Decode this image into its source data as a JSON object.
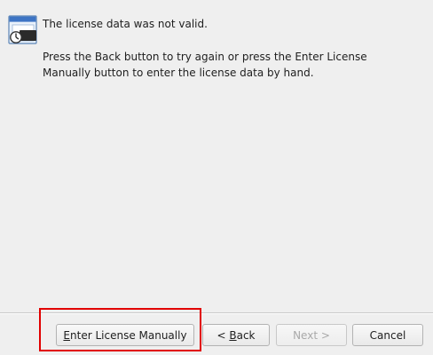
{
  "icon": {
    "name": "wizard-window-icon"
  },
  "message": {
    "title": "The license data was not valid.",
    "body": "Press the Back button to try again or press the Enter License Manually button to enter the license data by hand."
  },
  "buttons": {
    "enter_manual": {
      "mnemonic": "E",
      "rest": "nter License Manually"
    },
    "back": {
      "prefix": "< ",
      "mnemonic": "B",
      "rest": "ack"
    },
    "next": {
      "label": "Next >",
      "enabled": false
    },
    "cancel": {
      "label": "Cancel"
    }
  },
  "colors": {
    "background": "#efefef",
    "highlight": "#e10000",
    "disabled_text": "#a9a9a9"
  }
}
